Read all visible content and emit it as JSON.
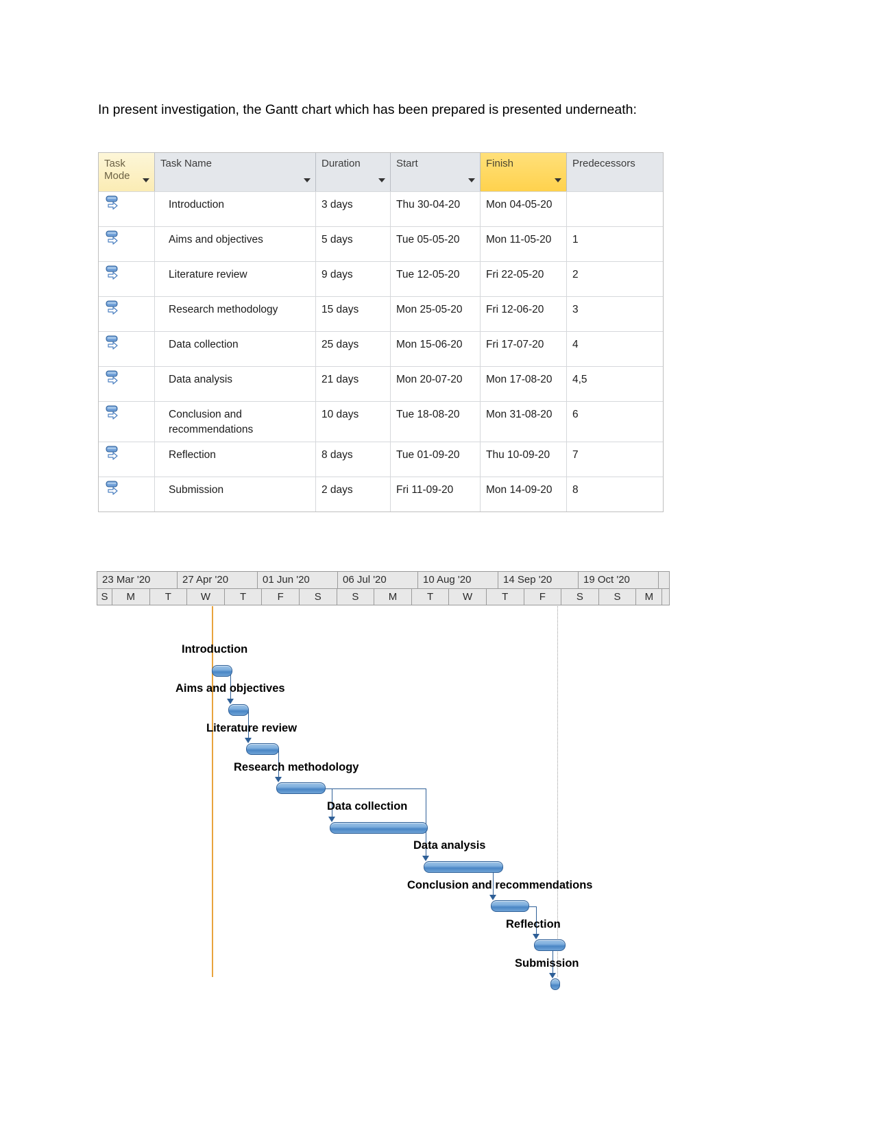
{
  "intro": {
    "paragraph": "In present investigation, the Gantt chart which has been prepared is presented underneath:"
  },
  "task_table": {
    "columns": [
      {
        "key": "mode",
        "label": "Task Mode",
        "highlight": "light"
      },
      {
        "key": "name",
        "label": "Task Name",
        "highlight": "none"
      },
      {
        "key": "dur",
        "label": "Duration",
        "highlight": "none"
      },
      {
        "key": "start",
        "label": "Start",
        "highlight": "none"
      },
      {
        "key": "finish",
        "label": "Finish",
        "highlight": "gold"
      },
      {
        "key": "pred",
        "label": "Predecessors",
        "highlight": "none"
      }
    ],
    "rows": [
      {
        "mode_icon": "manual-task-mode-icon",
        "name": "Introduction",
        "duration": "3 days",
        "start": "Thu 30-04-20",
        "finish": "Mon 04-05-20",
        "predecessors": ""
      },
      {
        "mode_icon": "manual-task-mode-icon",
        "name": "Aims and objectives",
        "duration": "5 days",
        "start": "Tue 05-05-20",
        "finish": "Mon 11-05-20",
        "predecessors": "1"
      },
      {
        "mode_icon": "manual-task-mode-icon",
        "name": "Literature review",
        "duration": "9 days",
        "start": "Tue 12-05-20",
        "finish": "Fri 22-05-20",
        "predecessors": "2"
      },
      {
        "mode_icon": "manual-task-mode-icon",
        "name": "Research methodology",
        "duration": "15 days",
        "start": "Mon 25-05-20",
        "finish": "Fri 12-06-20",
        "predecessors": "3"
      },
      {
        "mode_icon": "manual-task-mode-icon",
        "name": "Data collection",
        "duration": "25 days",
        "start": "Mon 15-06-20",
        "finish": "Fri 17-07-20",
        "predecessors": "4"
      },
      {
        "mode_icon": "manual-task-mode-icon",
        "name": "Data analysis",
        "duration": "21 days",
        "start": "Mon 20-07-20",
        "finish": "Mon 17-08-20",
        "predecessors": "4,5"
      },
      {
        "mode_icon": "manual-task-mode-icon",
        "name": "Conclusion and recommendations",
        "duration": "10 days",
        "start": "Tue 18-08-20",
        "finish": "Mon 31-08-20",
        "predecessors": "6"
      },
      {
        "mode_icon": "manual-task-mode-icon",
        "name": "Reflection",
        "duration": "8 days",
        "start": "Tue 01-09-20",
        "finish": "Thu 10-09-20",
        "predecessors": "7"
      },
      {
        "mode_icon": "manual-task-mode-icon",
        "name": "Submission",
        "duration": "2 days",
        "start": "Fri 11-09-20",
        "finish": "Mon 14-09-20",
        "predecessors": "8"
      }
    ]
  },
  "chart_data": {
    "type": "bar",
    "subtype": "gantt",
    "title": "Gantt chart",
    "xlabel": "",
    "ylabel": "",
    "grid": false,
    "legend": "none",
    "timeline": {
      "major_label": "Week-of start date",
      "major_ticks": [
        "23 Mar '20",
        "27 Apr '20",
        "01 Jun '20",
        "06 Jul '20",
        "10 Aug '20",
        "14 Sep '20",
        "19 Oct '20"
      ],
      "minor_label": "Day of week",
      "minor_ticks": [
        "S",
        "M",
        "T",
        "W",
        "T",
        "F",
        "S",
        "S",
        "M",
        "T",
        "W",
        "T",
        "F",
        "S",
        "S",
        "M"
      ],
      "axis_range": [
        "2020-03-23",
        "2020-10-19"
      ]
    },
    "markers": [
      {
        "name": "today-line",
        "color": "#e8a33d",
        "style": "solid"
      },
      {
        "name": "project-finish-line",
        "color": "#9a9a9a",
        "style": "dotted"
      }
    ],
    "bar_color": "#4a86c5",
    "link_color": "#2e5f97",
    "categories": [
      "Introduction",
      "Aims and objectives",
      "Literature review",
      "Research methodology",
      "Data collection",
      "Data analysis",
      "Conclusion and recommendations",
      "Reflection",
      "Submission"
    ],
    "tasks": [
      {
        "name": "Introduction",
        "start": "Thu 30-04-20",
        "finish": "Mon 04-05-20",
        "duration_days": 3,
        "predecessors": ""
      },
      {
        "name": "Aims and objectives",
        "start": "Tue 05-05-20",
        "finish": "Mon 11-05-20",
        "duration_days": 5,
        "predecessors": "1"
      },
      {
        "name": "Literature review",
        "start": "Tue 12-05-20",
        "finish": "Fri 22-05-20",
        "duration_days": 9,
        "predecessors": "2"
      },
      {
        "name": "Research methodology",
        "start": "Mon 25-05-20",
        "finish": "Fri 12-06-20",
        "duration_days": 15,
        "predecessors": "3"
      },
      {
        "name": "Data collection",
        "start": "Mon 15-06-20",
        "finish": "Fri 17-07-20",
        "duration_days": 25,
        "predecessors": "4"
      },
      {
        "name": "Data analysis",
        "start": "Mon 20-07-20",
        "finish": "Mon 17-08-20",
        "duration_days": 21,
        "predecessors": "4,5"
      },
      {
        "name": "Conclusion and recommendations",
        "start": "Tue 18-08-20",
        "finish": "Mon 31-08-20",
        "duration_days": 10,
        "predecessors": "6"
      },
      {
        "name": "Reflection",
        "start": "Tue 01-09-20",
        "finish": "Thu 10-09-20",
        "duration_days": 8,
        "predecessors": "7"
      },
      {
        "name": "Submission",
        "start": "Fri 11-09-20",
        "finish": "Mon 14-09-20",
        "duration_days": 2,
        "predecessors": "8"
      }
    ]
  }
}
